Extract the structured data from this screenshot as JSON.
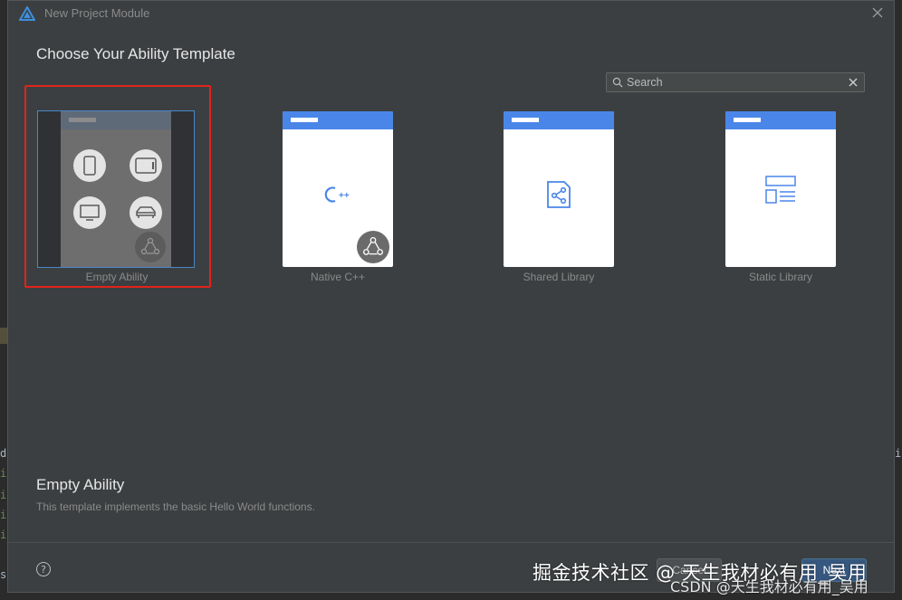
{
  "window": {
    "title": "New Project Module",
    "close_icon": "close-icon",
    "logo_icon": "app-logo-icon"
  },
  "page": {
    "heading": "Choose Your Ability Template"
  },
  "search": {
    "placeholder": "Search",
    "value": ""
  },
  "templates": [
    {
      "label": "Empty Ability",
      "selected": true
    },
    {
      "label": "Native C++",
      "selected": false
    },
    {
      "label": "Shared Library",
      "selected": false
    },
    {
      "label": "Static Library",
      "selected": false
    }
  ],
  "native_cpp_glyph": "C++",
  "description": {
    "title": "Empty Ability",
    "text": "This template implements the basic Hello World functions."
  },
  "footer": {
    "help_label": "?",
    "cancel_label": "Cancel",
    "next_label": "Next"
  },
  "watermark": {
    "line1": "掘金技术社区 @ 天生我材必有用_吴用",
    "line2": "CSDN @天生我材必有用_吴用"
  },
  "colors": {
    "accent": "#4a86e8",
    "selection_border": "#4a88c7",
    "highlight_box": "#e0241b",
    "dialog_bg": "#3c3f41"
  }
}
